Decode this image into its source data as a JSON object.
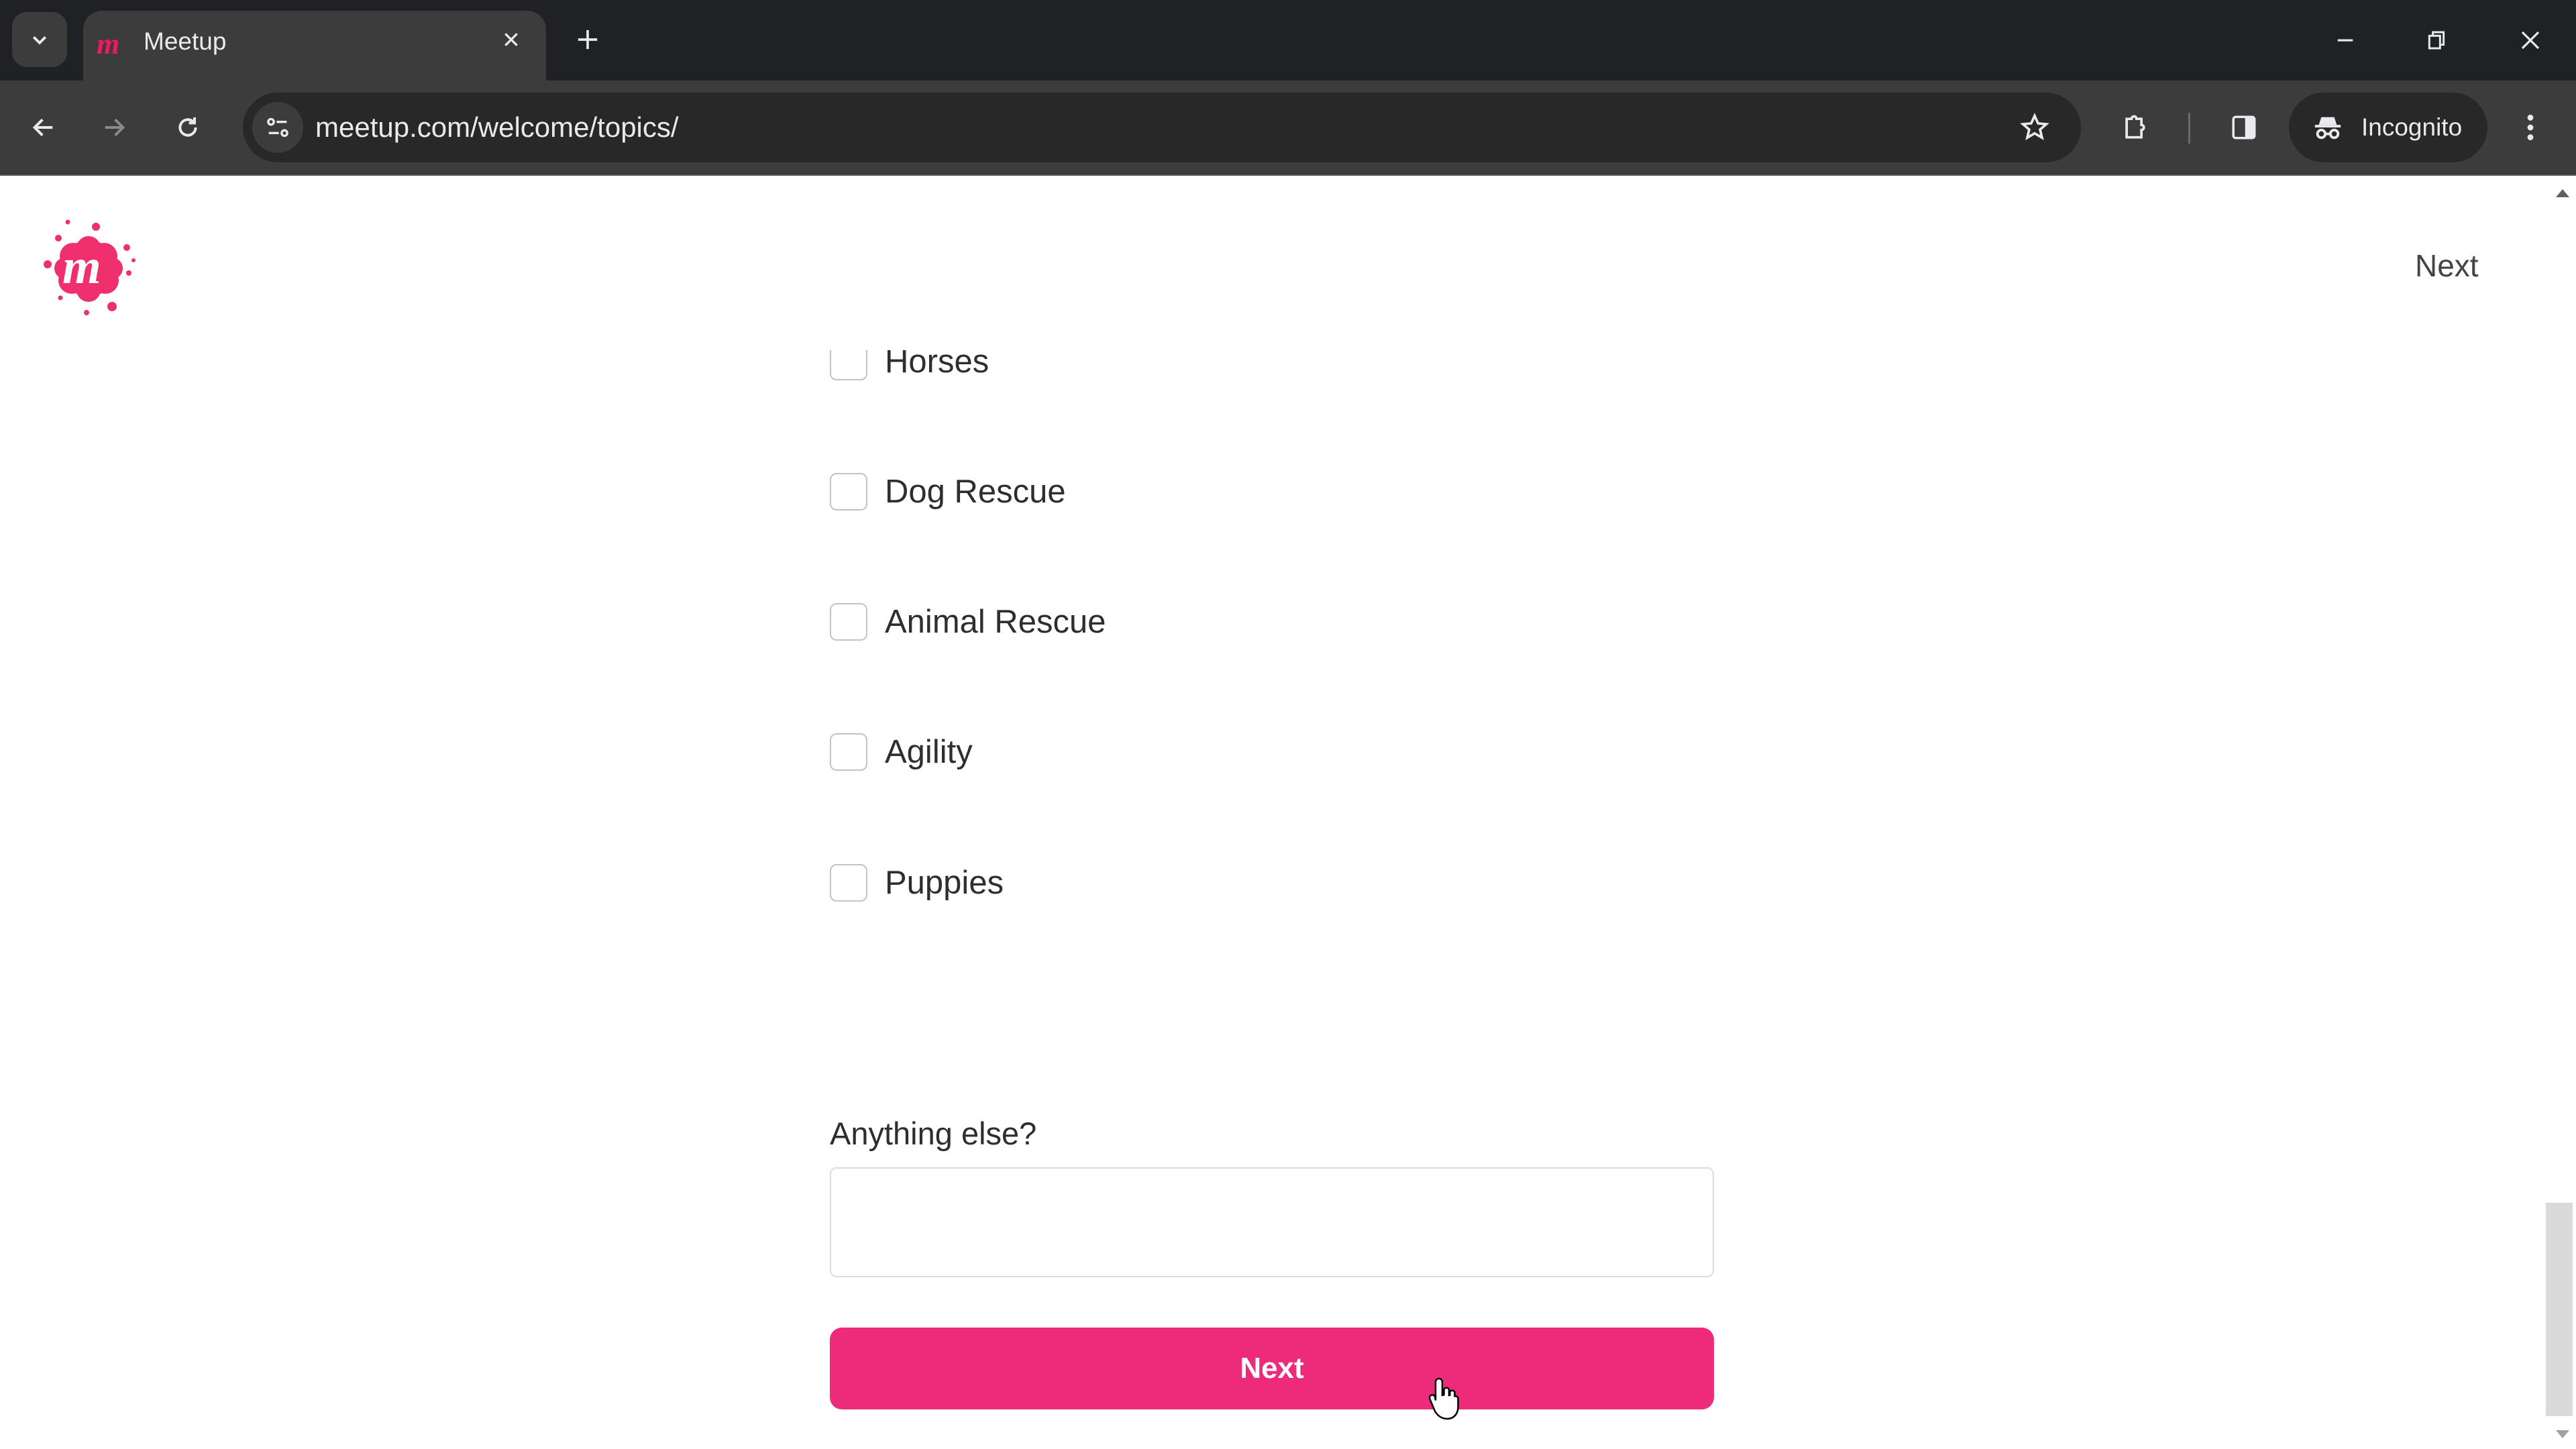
{
  "browser": {
    "tab": {
      "title": "Meetup"
    },
    "url": "meetup.com/welcome/topics/",
    "profile_label": "Incognito",
    "colors": {
      "tabstrip": "#202124",
      "toolbar": "#3c3c3c",
      "omnibox": "#282828"
    }
  },
  "header": {
    "next_label": "Next",
    "brand_color": "#ee2a7b"
  },
  "topics": [
    {
      "label": "Horses",
      "checked": false
    },
    {
      "label": "Dog Rescue",
      "checked": false
    },
    {
      "label": "Animal Rescue",
      "checked": false
    },
    {
      "label": "Agility",
      "checked": false
    },
    {
      "label": "Puppies",
      "checked": false
    }
  ],
  "anything_else": {
    "label": "Anything else?",
    "value": "",
    "placeholder": ""
  },
  "next_button": {
    "label": "Next",
    "color": "#ee2a7b"
  }
}
